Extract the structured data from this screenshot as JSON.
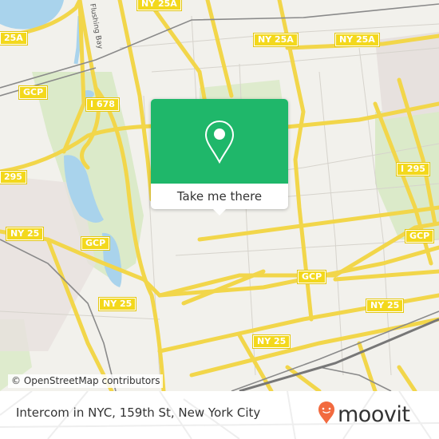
{
  "map": {
    "shields": [
      {
        "label": "25A",
        "id": "shield-25a-left"
      },
      {
        "label": "NY 25A",
        "id": "shield-ny25a-top"
      },
      {
        "label": "NY 25A",
        "id": "shield-ny25a-mid"
      },
      {
        "label": "NY 25A",
        "id": "shield-ny25a-right"
      },
      {
        "label": "GCP",
        "id": "shield-gcp-nw"
      },
      {
        "label": "I 678",
        "id": "shield-i678"
      },
      {
        "label": "295",
        "id": "shield-295-left"
      },
      {
        "label": "I 295",
        "id": "shield-i295"
      },
      {
        "label": "NY 25",
        "id": "shield-ny25-west"
      },
      {
        "label": "GCP",
        "id": "shield-gcp-west"
      },
      {
        "label": "GCP",
        "id": "shield-gcp-east"
      },
      {
        "label": "GCP",
        "id": "shield-gcp-center"
      },
      {
        "label": "NY 25",
        "id": "shield-ny25-sw"
      },
      {
        "label": "NY 25",
        "id": "shield-ny25-se"
      },
      {
        "label": "NY 25",
        "id": "shield-ny25-south"
      }
    ],
    "street_label": "Flushing Bay",
    "colors": {
      "land": "#f2f1ec",
      "water": "#a9d3ec",
      "park": "#d5e8c1",
      "road": "#f7e36a",
      "rail": "#888888",
      "brand_green": "#1fb76a",
      "moovit_orange": "#f26a3f"
    }
  },
  "popup": {
    "icon": "location-pin-icon",
    "button_label": "Take me there"
  },
  "attribution": "© OpenStreetMap contributors",
  "footer": {
    "title": "Intercom in NYC, 159th St, New York City",
    "logo_text": "moovit"
  }
}
